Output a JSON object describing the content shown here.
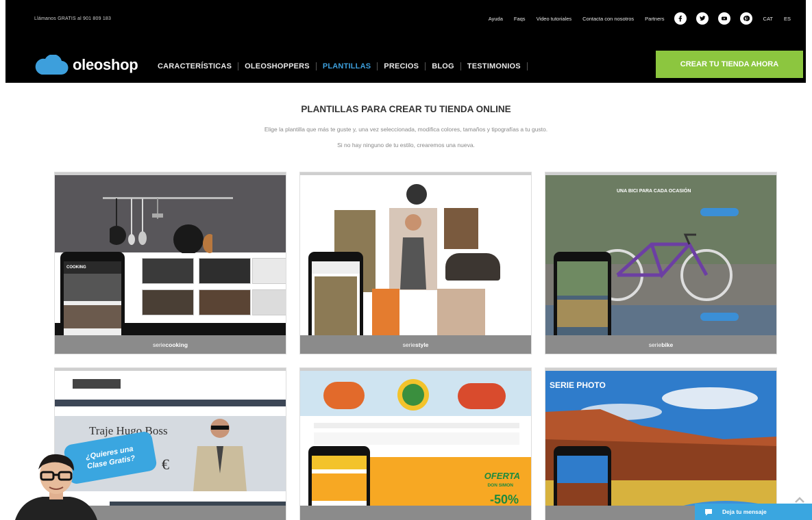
{
  "header": {
    "hotline": "Llámanos GRATIS al 901 809 183",
    "top_links": [
      "Ayuda",
      "Faqs",
      "Video tutoriales",
      "Contacta con nosotros",
      "Partners"
    ],
    "languages": [
      "CAT",
      "ES"
    ],
    "social_icons": [
      "facebook-icon",
      "twitter-icon",
      "youtube-icon",
      "pinterest-icon"
    ],
    "brand_name": "oleoshop",
    "nav": [
      "CARACTERÍSTICAS",
      "OLEOSHOPPERS",
      "PLANTILLAS",
      "PRECIOS",
      "BLOG",
      "TESTIMONIOS"
    ],
    "nav_active": "PLANTILLAS",
    "cta_label": "CREAR TU TIENDA AHORA"
  },
  "intro": {
    "title": "PLANTILLAS PARA CREAR TU TIENDA ONLINE",
    "line1": "Elige la plantilla que más te guste y, una vez seleccionada, modifica colores, tamaños y tipografías a tu gusto.",
    "line2": "Si no hay ninguno de tu estilo, crearemos una nueva."
  },
  "templates": [
    {
      "prefix": "serie",
      "name": "cooking"
    },
    {
      "prefix": "serie",
      "name": "style"
    },
    {
      "prefix": "serie",
      "name": "bike"
    },
    {
      "prefix": "",
      "name": ""
    },
    {
      "prefix": "",
      "name": ""
    },
    {
      "prefix": "",
      "name": ""
    }
  ],
  "previews": {
    "cooking_phone_title": "COOKING",
    "bike_headline": "UNA BICI PARA CADA OCASIÓN",
    "boss_title": "Traje Hugo Boss",
    "boss_price": "€",
    "food_offer": "OFERTA",
    "food_brand": "DON SIMON",
    "food_discount": "-50%",
    "photo_title": "SERIE PHOTO"
  },
  "promo_bubble": "¿Quieres una Clase Gratis?",
  "chat_label": "Deja tu mensaje",
  "colors": {
    "accent_green": "#8cc63f",
    "accent_blue": "#3d9fdc",
    "header_bg": "#000000",
    "chat_blue": "#3aa6e0"
  }
}
